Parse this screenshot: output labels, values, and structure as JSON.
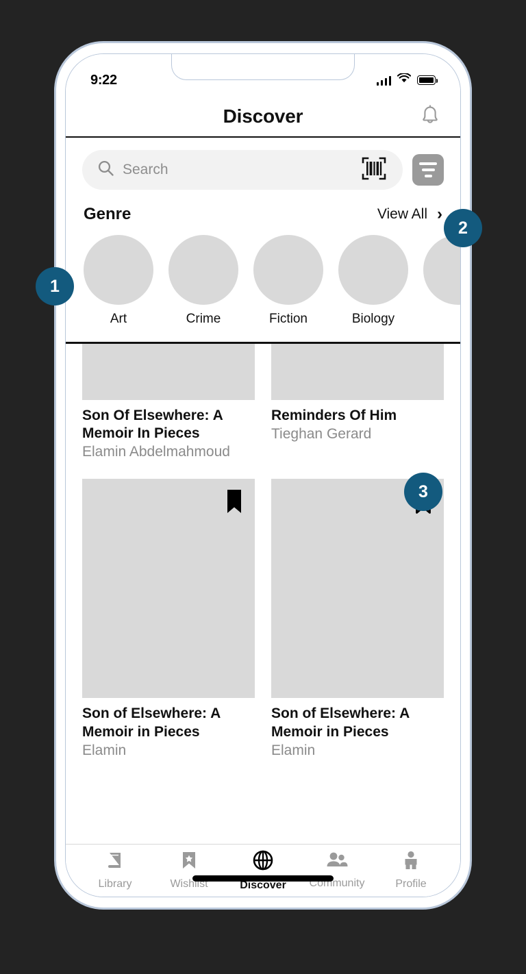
{
  "status_bar": {
    "time": "9:22",
    "signal_icon": "cellular-signal-icon",
    "wifi_icon": "wifi-icon",
    "battery_icon": "battery-full-icon"
  },
  "header": {
    "title": "Discover",
    "notification_icon": "bell-icon"
  },
  "search": {
    "placeholder": "Search",
    "search_icon": "search-icon",
    "barcode_icon": "barcode-scanner-icon",
    "filter_icon": "filter-icon"
  },
  "genre_section": {
    "title": "Genre",
    "view_all_label": "View All",
    "chevron_icon": "chevron-right-icon",
    "items": [
      {
        "label": "Art"
      },
      {
        "label": "Crime"
      },
      {
        "label": "Fiction"
      },
      {
        "label": "Biology"
      },
      {
        "label": ""
      }
    ]
  },
  "books": {
    "row1": [
      {
        "title": "Son Of Elsewhere: A Memoir In Pieces",
        "author": "Elamin Abdelmahmoud"
      },
      {
        "title": "Reminders Of Him",
        "author": "Tieghan Gerard"
      }
    ],
    "row2": [
      {
        "title": "Son of Elsewhere: A Memoir in Pieces",
        "author": "Elamin",
        "bookmark_icon": "bookmark-filled-icon",
        "bookmarked": true
      },
      {
        "title": "Son of Elsewhere: A Memoir in Pieces",
        "author": "Elamin",
        "bookmark_icon": "bookmark-outline-icon",
        "bookmarked": false
      }
    ]
  },
  "tabs": [
    {
      "label": "Library",
      "icon": "book-icon",
      "active": false
    },
    {
      "label": "Wishlist",
      "icon": "bookmark-star-icon",
      "active": false
    },
    {
      "label": "Discover",
      "icon": "globe-icon",
      "active": true
    },
    {
      "label": "Community",
      "icon": "people-icon",
      "active": false
    },
    {
      "label": "Profile",
      "icon": "person-icon",
      "active": false
    }
  ],
  "annotations": [
    {
      "number": "1"
    },
    {
      "number": "2"
    },
    {
      "number": "3"
    }
  ],
  "colors": {
    "badge": "#135a7e",
    "placeholder": "#d9d9d9",
    "frame": "#b9c7da",
    "backdrop": "#232323"
  }
}
